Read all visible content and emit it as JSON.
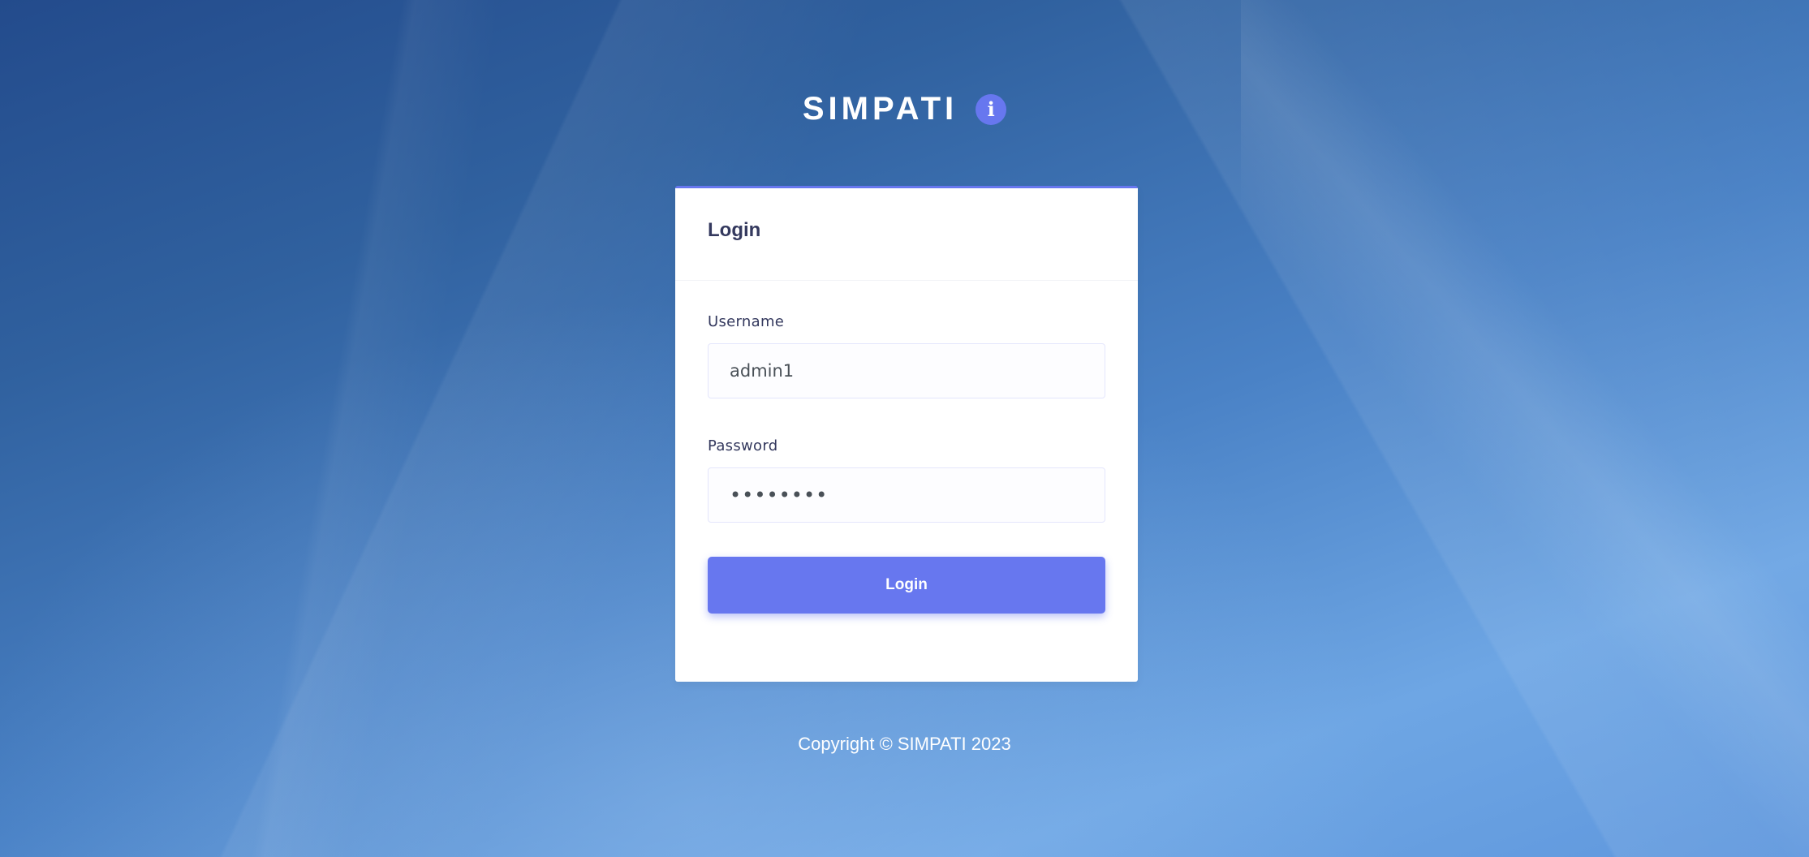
{
  "brand": {
    "title": "SIMPATI",
    "info_icon": "info-icon",
    "info_glyph": "i"
  },
  "login_card": {
    "title": "Login",
    "accent_color": "#6777ef",
    "username": {
      "label": "Username",
      "value": "admin1"
    },
    "password": {
      "label": "Password",
      "value": "••••••••"
    },
    "submit_label": "Login"
  },
  "footer": {
    "copyright": "Copyright © SIMPATI 2023"
  }
}
